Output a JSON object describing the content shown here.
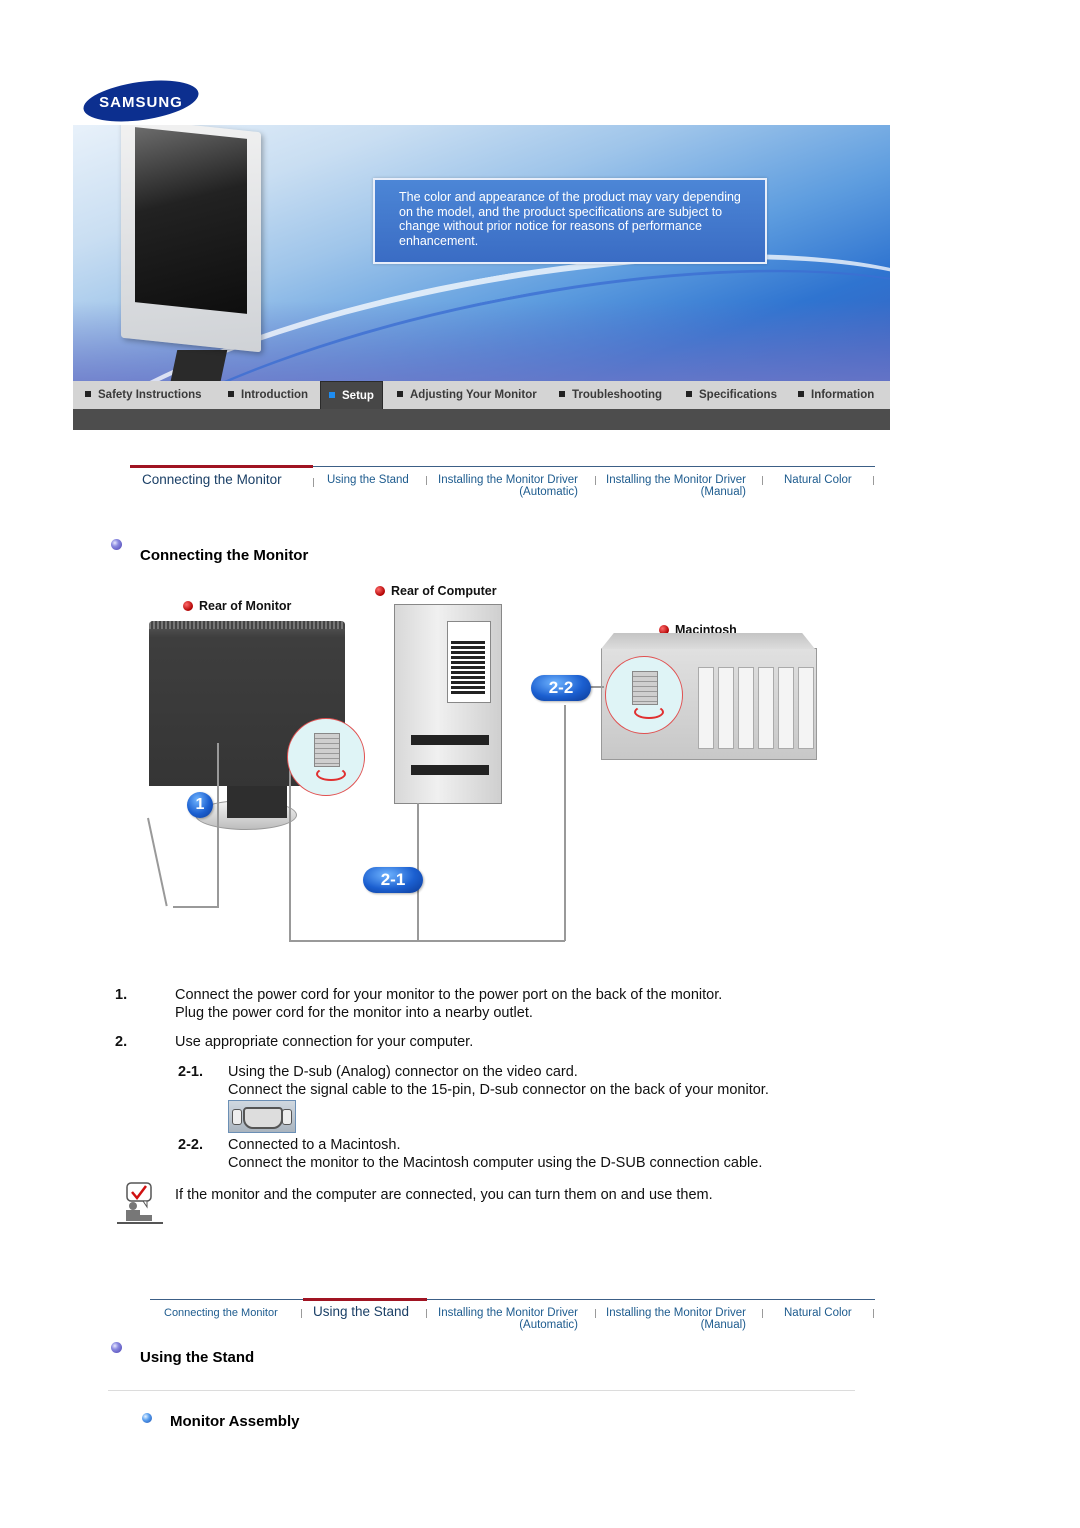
{
  "brand": {
    "logo_text": "SAMSUNG",
    "logo_color": "#0c2f8f"
  },
  "banner": {
    "notice": "The color and appearance of the product may vary depending on the model, and the product specifications are subject to change without prior notice for reasons of performance enhancement."
  },
  "main_nav": {
    "items": [
      {
        "label": "Safety Instructions",
        "active": false
      },
      {
        "label": "Introduction",
        "active": false
      },
      {
        "label": "Setup",
        "active": true
      },
      {
        "label": "Adjusting Your Monitor",
        "active": false
      },
      {
        "label": "Troubleshooting",
        "active": false
      },
      {
        "label": "Specifications",
        "active": false
      },
      {
        "label": "Information",
        "active": false
      }
    ],
    "active_color": "#1e8cf0"
  },
  "sub_nav": {
    "items": [
      {
        "line1": "Connecting  the  Monitor",
        "line2": ""
      },
      {
        "line1": "Using the Stand",
        "line2": ""
      },
      {
        "line1": "Installing the Monitor Driver",
        "line2": "(Automatic)"
      },
      {
        "line1": "Installing the Monitor Driver",
        "line2": "(Manual)"
      },
      {
        "line1": "Natural Color",
        "line2": ""
      }
    ],
    "accent_color": "#a01422",
    "link_color": "#1d5b8e"
  },
  "section1": {
    "title": "Connecting the Monitor",
    "diagram": {
      "label_rear_monitor": "Rear of Monitor",
      "label_rear_computer": "Rear of Computer",
      "label_macintosh": "Macintosh",
      "badge_1": "1",
      "badge_2_1": "2-1",
      "badge_2_2": "2-2"
    },
    "steps": [
      {
        "num": "1.",
        "lines": [
          "Connect the power cord for your monitor to the power port on the back of the monitor.",
          "Plug the power cord for the monitor into a nearby outlet."
        ]
      },
      {
        "num": "2.",
        "lines": [
          "Use appropriate connection for your computer."
        ],
        "substeps": [
          {
            "num": "2-1.",
            "lines": [
              "Using the D-sub (Analog) connector on the video card.",
              "Connect the signal cable to the 15-pin, D-sub connector on the back of your monitor."
            ],
            "icon": "d-sub-connector-icon"
          },
          {
            "num": "2-2.",
            "lines": [
              "Connected to a Macintosh.",
              "Connect the monitor to the Macintosh computer using the D-SUB connection cable."
            ]
          }
        ]
      }
    ],
    "note": "If the monitor and the computer are connected, you can turn them on and use them."
  },
  "section2": {
    "title": "Using the Stand",
    "subheading": "Monitor Assembly"
  }
}
